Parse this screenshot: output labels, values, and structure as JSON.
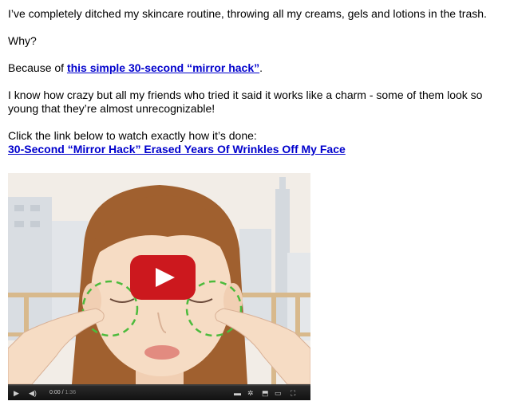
{
  "article": {
    "p1": "I’ve completely ditched my skincare routine, throwing all my creams, gels and lotions in the trash.",
    "p2": "Why?",
    "p3_prefix": "Because of ",
    "p3_link": "this simple 30-second “mirror hack”",
    "p3_suffix": ".",
    "p4": "I know how crazy but all my friends who tried it said it works like a charm - some of them look so young that they’re almost unrecognizable!",
    "p5": "Click the link below to watch exactly how it’s done:",
    "p5_link": "30-Second “Mirror Hack” Erased Years Of Wrinkles Off My Face"
  },
  "video": {
    "current_time": "0:00",
    "total_time": "1:36",
    "play_icon": "play-icon",
    "colors": {
      "youtube_red": "#cc181e",
      "hair": "#a0602f",
      "skin": "#f6dcc4",
      "guide_green": "#4cbb3c"
    }
  }
}
